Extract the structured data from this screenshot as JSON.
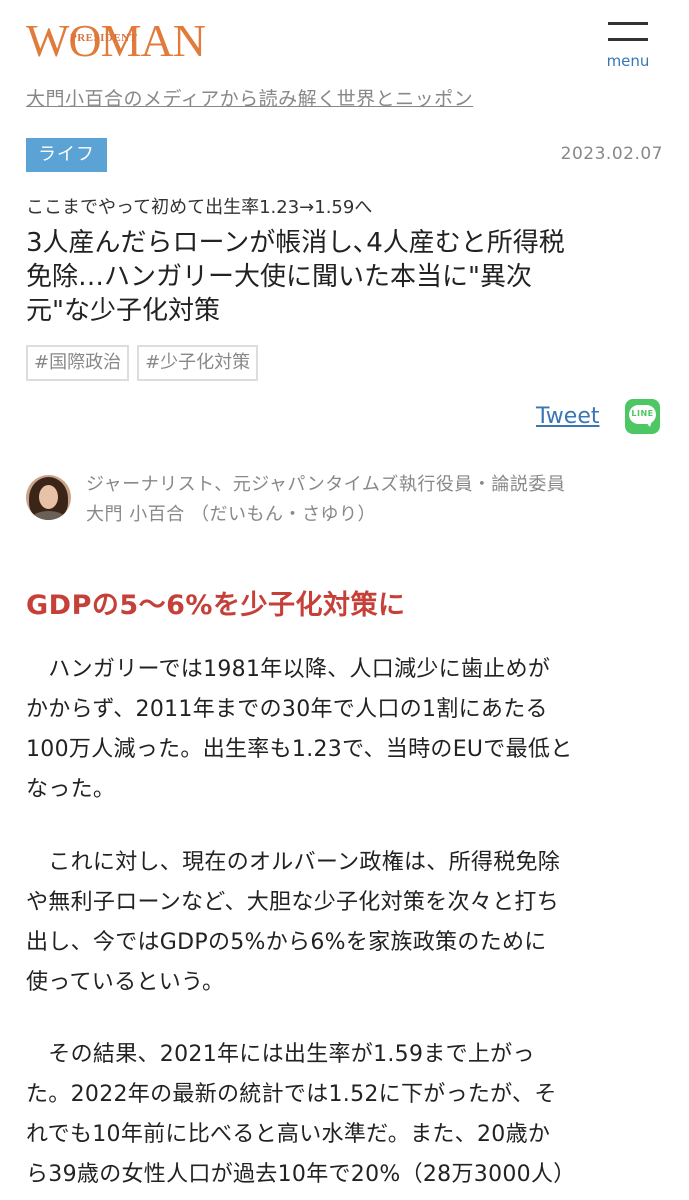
{
  "header": {
    "logo_small": "PRESIDENT",
    "logo_large": "WOMAN",
    "menu_label": "menu"
  },
  "series_link": "大門小百合のメディアから読み解く世界とニッポン",
  "article": {
    "category": "ライフ",
    "date": "2023.02.07",
    "subtitle": "ここまでやって初めて出生率1.23→1.59へ",
    "title_lines": [
      "3人産んだらローンが帳消し､4人産むと所得税",
      "免除…ハンガリー大使に聞いた本当に\"異次",
      "元\"な少子化対策"
    ],
    "tags": [
      "#国際政治",
      "#少子化対策"
    ]
  },
  "share": {
    "tweet_label": "Tweet",
    "line_label": "LINE"
  },
  "author": {
    "role": "ジャーナリスト、元ジャパンタイムズ執行役員・論説委員",
    "name": "大門 小百合 （だいもん・さゆり）"
  },
  "section_heading": "GDPの5～6%を少子化対策に",
  "paragraphs": [
    [
      "　ハンガリーでは1981年以降、人口減少に歯止めが",
      "かからず、2011年までの30年で人口の1割にあたる",
      "100万人減った。出生率も1.23で、当時のEUで最低と",
      "なった。"
    ],
    [
      "　これに対し、現在のオルバーン政権は、所得税免除",
      "や無利子ローンなど、大胆な少子化対策を次々と打ち",
      "出し、今ではGDPの5%から6%を家族政策のために",
      "使っているという。"
    ],
    [
      "　その結果、2021年には出生率が1.59まで上がっ",
      "た。2022年の最新の統計では1.52に下がったが、そ",
      "れでも10年前に比べると高い水準だ。また、20歳か",
      "ら39歳の女性人口が過去10年で20%（28万3000人）"
    ]
  ]
}
